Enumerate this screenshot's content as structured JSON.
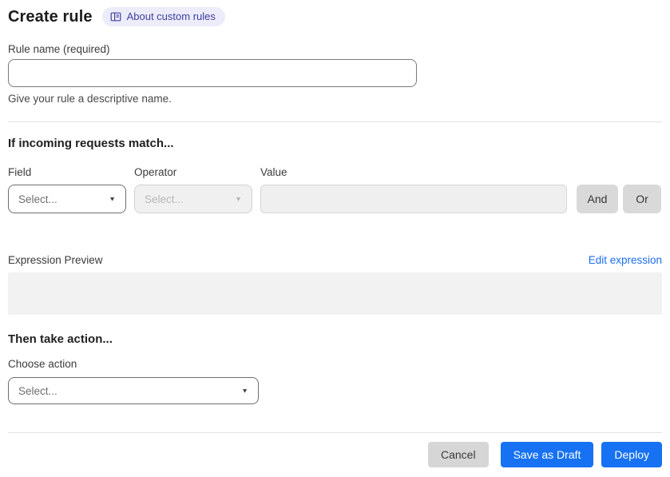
{
  "header": {
    "title": "Create rule",
    "about_badge_label": "About custom rules"
  },
  "rule_name": {
    "label": "Rule name (required)",
    "value": "",
    "helper": "Give your rule a descriptive name."
  },
  "match_section": {
    "heading": "If incoming requests match...",
    "field": {
      "label": "Field",
      "selected": "Select..."
    },
    "operator": {
      "label": "Operator",
      "selected": "Select..."
    },
    "value": {
      "label": "Value",
      "value": ""
    },
    "and_button": "And",
    "or_button": "Or"
  },
  "expression": {
    "label": "Expression Preview",
    "edit_link": "Edit expression",
    "preview_text": ""
  },
  "action_section": {
    "heading": "Then take action...",
    "choose_label": "Choose action",
    "selected": "Select..."
  },
  "footer": {
    "cancel": "Cancel",
    "save_draft": "Save as Draft",
    "deploy": "Deploy"
  },
  "icons": {
    "badge": "book-icon",
    "selects": "chevron-down-icon"
  },
  "colors": {
    "primary_blue": "#1672F2",
    "link_blue": "#1A6EF0",
    "badge_bg": "#ECECFB",
    "badge_text": "#40409F",
    "neutral_button_bg": "#D9D9D9",
    "disabled_field_bg": "#F0F0F0",
    "preview_box_bg": "#F2F2F2"
  }
}
